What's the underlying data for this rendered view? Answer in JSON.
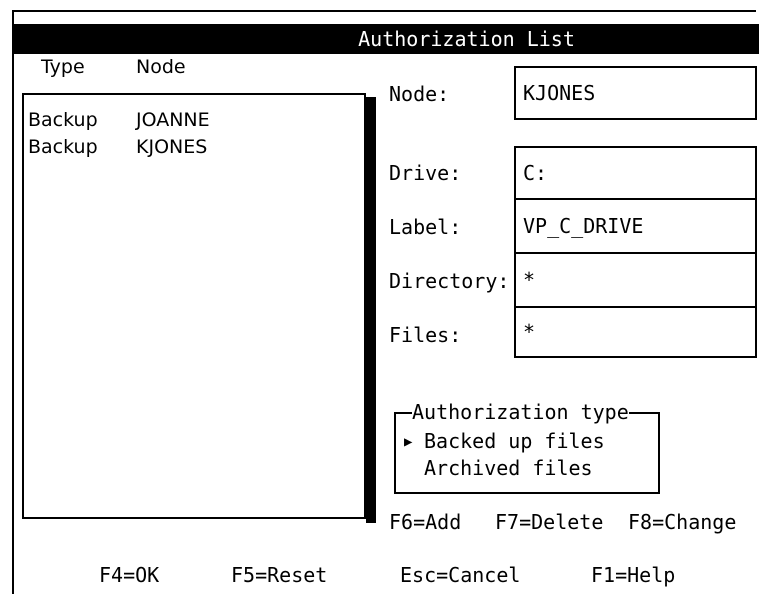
{
  "window": {
    "title": "Authorization List"
  },
  "list": {
    "headers": {
      "type": "Type",
      "node": "Node"
    },
    "rows": [
      {
        "type": "Backup",
        "node": "JOANNE"
      },
      {
        "type": "Backup",
        "node": "KJONES"
      }
    ]
  },
  "fields": {
    "node": {
      "label": "Node:",
      "value": "KJONES"
    },
    "drive": {
      "label": "Drive:",
      "value": "C:"
    },
    "label": {
      "label": "Label:",
      "value": "VP_C_DRIVE"
    },
    "directory": {
      "label": "Directory:",
      "value": "*"
    },
    "files": {
      "label": "Files:",
      "value": "*"
    }
  },
  "authorization_type": {
    "legend": "Authorization type",
    "options": [
      {
        "label": "Backed up files",
        "selected": true,
        "marker": "▶"
      },
      {
        "label": "Archived files",
        "selected": false,
        "marker": ""
      }
    ]
  },
  "keys": {
    "add": "F6=Add",
    "delete": "F7=Delete",
    "change": "F8=Change",
    "ok": "F4=OK",
    "reset": "F5=Reset",
    "cancel": "Esc=Cancel",
    "help": "F1=Help"
  }
}
